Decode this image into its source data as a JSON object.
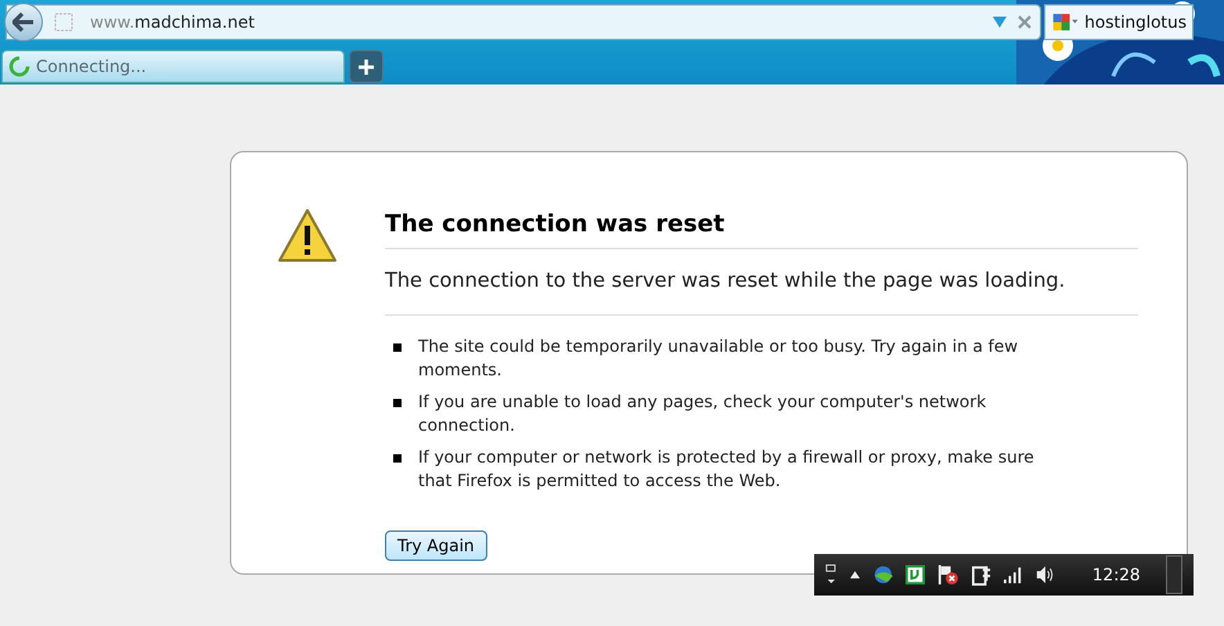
{
  "address_bar": {
    "url_prefix": "www.",
    "url_domain": "madchima.net"
  },
  "search_bar": {
    "value": "hostinglotus"
  },
  "tabs": [
    {
      "label": "Connecting...",
      "selected": true
    }
  ],
  "error": {
    "title": "The connection was reset",
    "message": "The connection to the server was reset while the page was loading.",
    "bullets": [
      "The site could be temporarily unavailable or too busy. Try again in a few moments.",
      "If you are unable to load any pages, check your computer's network connection.",
      "If your computer or network is protected by a firewall or proxy, make sure that Firefox is permitted to access the Web."
    ],
    "button": "Try Again"
  },
  "taskbar": {
    "clock": "12:28"
  }
}
